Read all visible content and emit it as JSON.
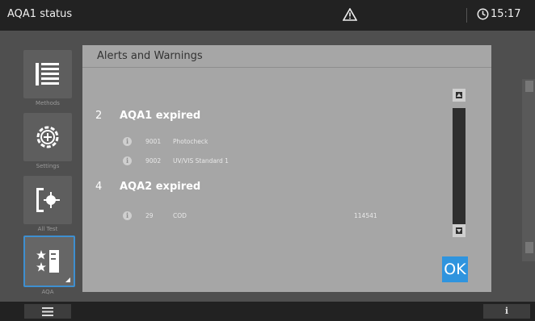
{
  "topbar": {
    "title": "AQA1 status",
    "warning_icon": "warning-triangle-icon",
    "clock_icon": "clock-icon",
    "time": "15:17"
  },
  "sidebar": {
    "items": [
      {
        "label": "Methods",
        "icon": "methods-list-icon"
      },
      {
        "label": "Settings",
        "icon": "settings-gear-icon"
      },
      {
        "label": "All Test",
        "icon": "all-test-icon"
      },
      {
        "label": "AQA",
        "icon": "aqa-icon",
        "active": true
      }
    ]
  },
  "dialog": {
    "title": "Alerts and Warnings",
    "groups": [
      {
        "count": "2",
        "title": "AQA1 expired",
        "items": [
          {
            "code": "9001",
            "desc": "Photocheck",
            "value": ""
          },
          {
            "code": "9002",
            "desc": "UV/VIS Standard 1",
            "value": ""
          }
        ]
      },
      {
        "count": "4",
        "title": "AQA2 expired",
        "items": [
          {
            "code": "29",
            "desc": "COD",
            "value": "114541"
          }
        ]
      }
    ],
    "ok_label": "OK"
  },
  "bottombar": {
    "menu_icon": "hamburger-menu-icon",
    "info_label": "i"
  },
  "colors": {
    "accent": "#2f94de",
    "dialog_bg": "#a6a6a6",
    "active_border": "#3e8fd0"
  }
}
